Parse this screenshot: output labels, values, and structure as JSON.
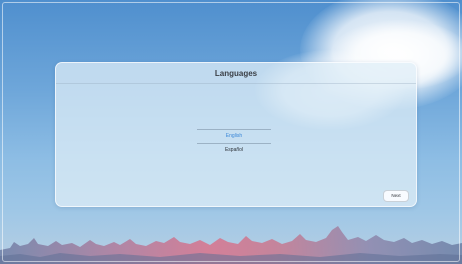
{
  "dialog": {
    "title": "Languages"
  },
  "languages": {
    "selected": "English",
    "options": [
      "English",
      "Español"
    ]
  },
  "actions": {
    "next_label": "Next"
  },
  "colors": {
    "accent": "#3b88d8",
    "panel": "#deeef7",
    "sky_top": "#4f8fce",
    "sky_bottom": "#b7cfe3"
  }
}
